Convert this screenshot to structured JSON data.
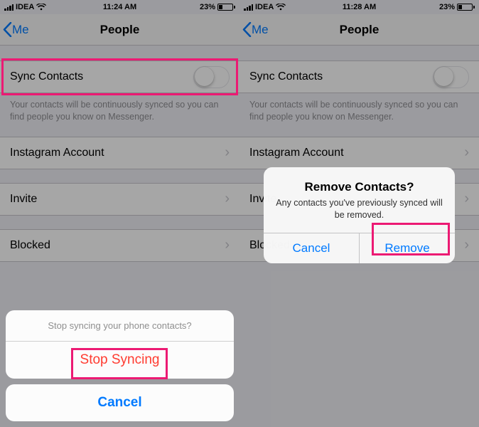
{
  "left": {
    "status": {
      "carrier": "IDEA",
      "time": "11:24 AM",
      "battery_pct": "23%"
    },
    "nav": {
      "back": "Me",
      "title": "People"
    },
    "sync": {
      "label": "Sync Contacts",
      "on": false,
      "desc": "Your contacts will be continuously synced so you can find people you know on Messenger."
    },
    "rows": {
      "instagram": "Instagram Account",
      "invite": "Invite",
      "blocked": "Blocked"
    },
    "sheet": {
      "title": "Stop syncing your phone contacts?",
      "stop": "Stop Syncing",
      "cancel": "Cancel"
    }
  },
  "right": {
    "status": {
      "carrier": "IDEA",
      "time": "11:28 AM",
      "battery_pct": "23%"
    },
    "nav": {
      "back": "Me",
      "title": "People"
    },
    "sync": {
      "label": "Sync Contacts",
      "on": false,
      "desc": "Your contacts will be continuously synced so you can find people you know on Messenger."
    },
    "rows": {
      "instagram": "Instagram Account",
      "invite": "Invite",
      "blocked": "Blocked"
    },
    "alert": {
      "title": "Remove Contacts?",
      "msg": "Any contacts you've previously synced will be removed.",
      "cancel": "Cancel",
      "remove": "Remove"
    }
  }
}
